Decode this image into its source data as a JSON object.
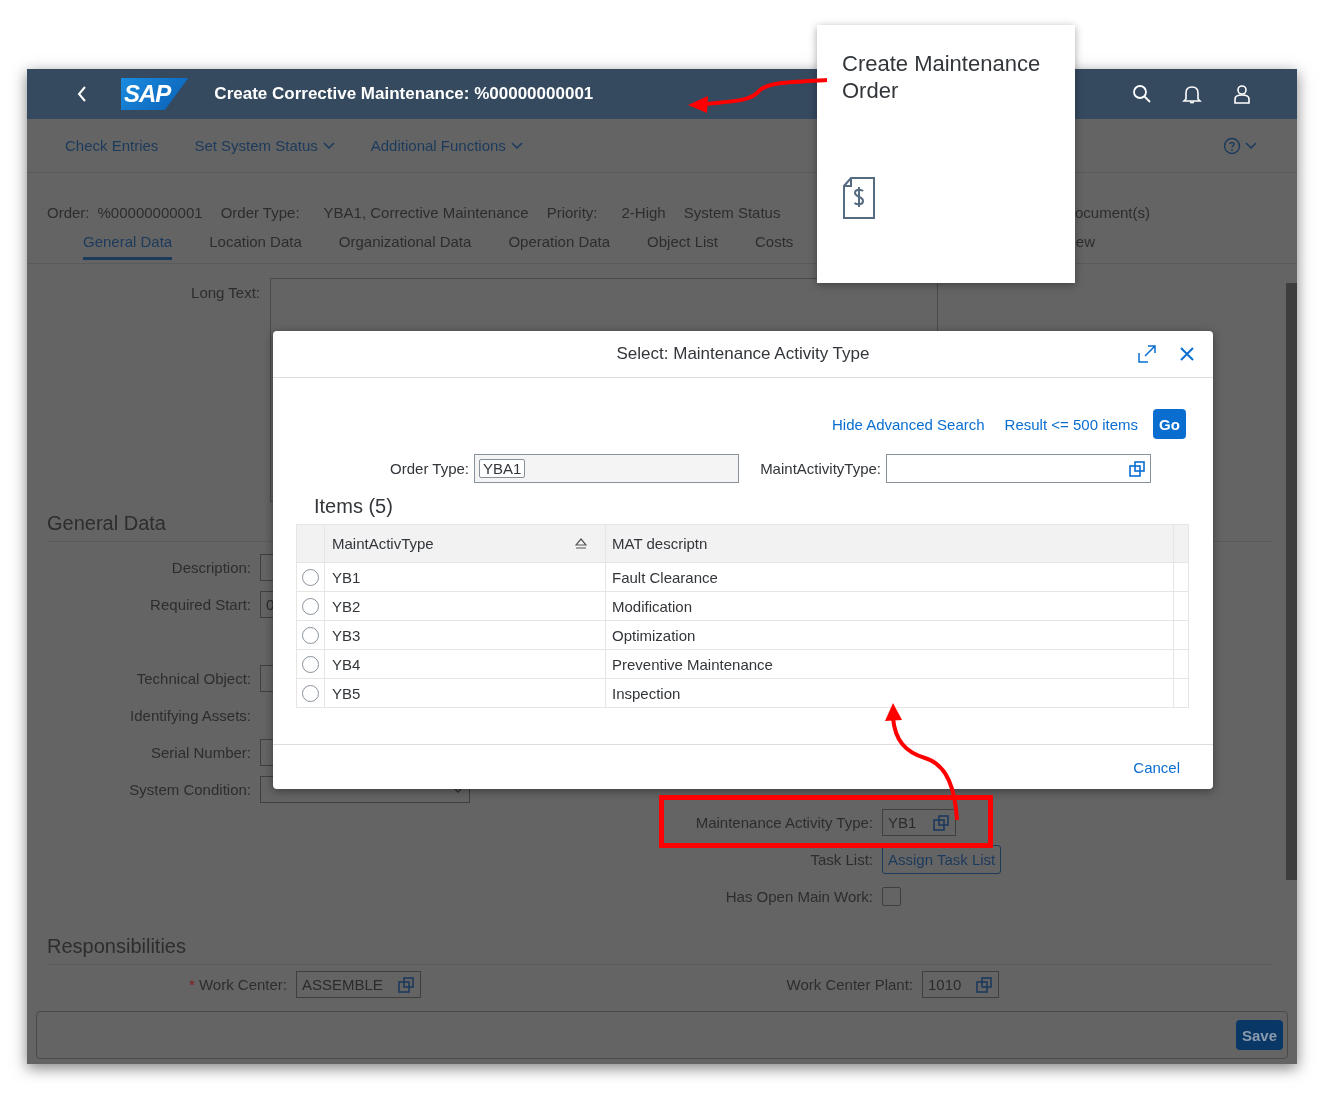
{
  "shell": {
    "logo": "SAP",
    "title": "Create Corrective Maintenance: %00000000001"
  },
  "toolbar": [
    {
      "label": "Check Entries",
      "dropdown": false
    },
    {
      "label": "Set System Status",
      "dropdown": true
    },
    {
      "label": "Additional Functions",
      "dropdown": true
    }
  ],
  "header": {
    "fields": [
      {
        "label": "Order:",
        "value": "%00000000001"
      },
      {
        "label": "Order Type:",
        "value": "YBA1, Corrective Maintenance"
      },
      {
        "label": "Priority:",
        "value": "2-High"
      },
      {
        "label": "System Status"
      }
    ],
    "trailing": "ocument(s)"
  },
  "tabs": [
    {
      "label": "General Data",
      "selected": true
    },
    {
      "label": "Location Data",
      "selected": false
    },
    {
      "label": "Organizational Data",
      "selected": false
    },
    {
      "label": "Operation Data",
      "selected": false
    },
    {
      "label": "Object List",
      "selected": false
    },
    {
      "label": "Costs",
      "selected": false
    },
    {
      "label": "ew",
      "selected": false
    }
  ],
  "long_text": {
    "label": "Long Text:"
  },
  "general_data": {
    "title": "General Data",
    "left": [
      {
        "label": "Description:",
        "kind": "input"
      },
      {
        "label": "Required Start:",
        "kind": "input",
        "value": "0"
      },
      {
        "label": "Technical Object:",
        "kind": "input"
      },
      {
        "label": "Identifying Assets:",
        "kind": "none"
      },
      {
        "label": "Serial Number:",
        "kind": "input"
      },
      {
        "label": "System Condition:",
        "kind": "select"
      }
    ],
    "right": [
      {
        "label": "Maintenance Activity Type:",
        "kind": "input",
        "value": "YB1",
        "value_help": true
      },
      {
        "label": "Task List:",
        "kind": "button",
        "value": "Assign Task List"
      },
      {
        "label": "Has Open Main Work:",
        "kind": "checkbox",
        "checked": false
      }
    ]
  },
  "responsibilities": {
    "title": "Responsibilities",
    "fields": [
      {
        "label": "Work Center:",
        "required_mark": "*",
        "value": "ASSEMBLE"
      },
      {
        "label": "Work Center Plant:",
        "value": "1010"
      }
    ]
  },
  "footer": {
    "button": "Save"
  },
  "dialog": {
    "title": "Select: Maintenance Activity Type",
    "links": [
      "Hide Advanced Search",
      "Result <= 500 items"
    ],
    "go": "Go",
    "filters": [
      {
        "label": "Order Type:",
        "token": "YBA1",
        "value_help": false
      },
      {
        "label": "MaintActivityType:",
        "value_help": true
      }
    ],
    "items_title": "Items (5)",
    "columns": [
      "MaintActivType",
      "MAT descriptn"
    ],
    "rows": [
      {
        "code": "YB1",
        "description": "Fault Clearance",
        "selected": false
      },
      {
        "code": "YB2",
        "description": "Modification",
        "selected": false
      },
      {
        "code": "YB3",
        "description": "Optimization",
        "selected": false
      },
      {
        "code": "YB4",
        "description": "Preventive Maintenance",
        "selected": false
      },
      {
        "code": "YB5",
        "description": "Inspection",
        "selected": false
      }
    ],
    "cancel": "Cancel"
  },
  "tile": {
    "title": "Create Maintenance Order"
  }
}
